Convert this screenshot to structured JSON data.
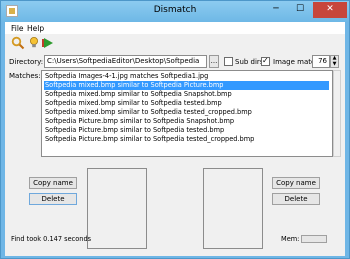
{
  "window": {
    "title": "Dismatch"
  },
  "menu": [
    {
      "label": "File"
    },
    {
      "label": "Help"
    }
  ],
  "directory": {
    "label": "Directory:",
    "value": "C:\\Users\\SoftpediaEditor\\Desktop\\Softpedia",
    "browse_label": "..."
  },
  "options": {
    "sub_dirs_label": "Sub dirs",
    "sub_dirs_checked": false,
    "image_match_label": "Image match",
    "image_match_checked": true,
    "threshold": "76"
  },
  "matches": {
    "label": "Matches:",
    "items": [
      "Softpedia Images-4-1.jpg matches Softpedia1.jpg",
      "Softpedia mixed.bmp similar to Softpedia Picture.bmp",
      "Softpedia mixed.bmp similar to Softpedia Snapshot.bmp",
      "Softpedia mixed.bmp similar to Softpedia tested.bmp",
      "Softpedia mixed.bmp similar to Softpedia tested_cropped.bmp",
      "Softpedia Picture.bmp similar to Softpedia Snapshot.bmp",
      "Softpedia Picture.bmp similar to Softpedia tested.bmp",
      "Softpedia Picture.bmp similar to Softpedia tested_cropped.bmp"
    ],
    "selected_index": 1
  },
  "buttons": {
    "copy_name": "Copy name",
    "delete": "Delete"
  },
  "status": {
    "find_text": "Find took 0.147 seconds",
    "mem_label": "Mem:"
  },
  "colors": {
    "selection": "#3399ff",
    "titlebar": "#6fb6e6",
    "close": "#c7463b"
  }
}
